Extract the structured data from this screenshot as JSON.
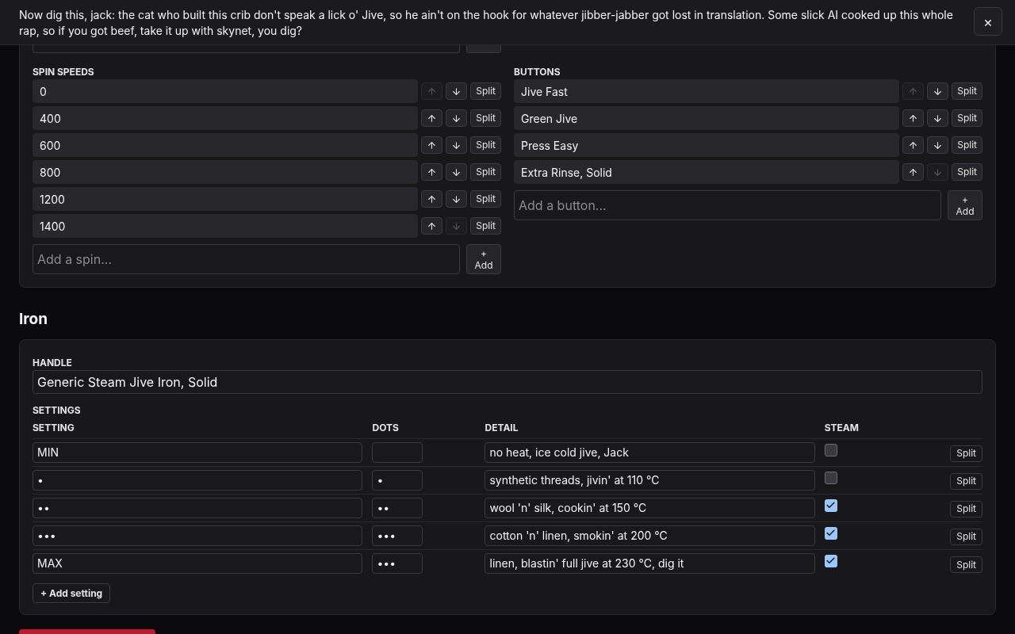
{
  "banner": {
    "text": "Now dig this, jack: the cat who built this crib don't speak a lick o' Jive, so he ain't on the hook for whatever jibber-jabber got lost in translation. Some slick AI cooked up this whole rap, so if you got beef, take it up with skynet, you dig?",
    "close": "×"
  },
  "spin_speeds": {
    "label": "SPIN SPEEDS",
    "items": [
      {
        "value": "0",
        "up_disabled": true,
        "down_disabled": false,
        "split": "Split"
      },
      {
        "value": "400",
        "up_disabled": false,
        "down_disabled": false,
        "split": "Split"
      },
      {
        "value": "600",
        "up_disabled": false,
        "down_disabled": false,
        "split": "Split"
      },
      {
        "value": "800",
        "up_disabled": false,
        "down_disabled": false,
        "split": "Split"
      },
      {
        "value": "1200",
        "up_disabled": false,
        "down_disabled": false,
        "split": "Split"
      },
      {
        "value": "1400",
        "up_disabled": false,
        "down_disabled": true,
        "split": "Split"
      }
    ],
    "placeholder": "Add a spin...",
    "add": [
      "+",
      "Add"
    ]
  },
  "buttons": {
    "label": "BUTTONS",
    "items": [
      {
        "value": "Jive Fast",
        "up_disabled": true,
        "down_disabled": false,
        "split": "Split"
      },
      {
        "value": "Green Jive",
        "up_disabled": false,
        "down_disabled": false,
        "split": "Split"
      },
      {
        "value": "Press Easy",
        "up_disabled": false,
        "down_disabled": false,
        "split": "Split"
      },
      {
        "value": "Extra Rinse, Solid",
        "up_disabled": false,
        "down_disabled": true,
        "split": "Split"
      }
    ],
    "placeholder": "Add a button...",
    "add": [
      "+",
      "Add"
    ]
  },
  "iron": {
    "title": "Iron",
    "handle_label": "HANDLE",
    "handle": "Generic Steam Jive Iron, Solid",
    "settings_label": "SETTINGS",
    "columns": [
      "SETTING",
      "DOTS",
      "DETAIL",
      "STEAM"
    ],
    "rows": [
      {
        "setting": "MIN",
        "dots": "",
        "detail": "no heat, ice cold jive, Jack",
        "steam": false,
        "split": "Split"
      },
      {
        "setting": "•",
        "dots": "•",
        "detail": "synthetic threads, jivin' at 110 °C",
        "steam": false,
        "split": "Split"
      },
      {
        "setting": "••",
        "dots": "••",
        "detail": "wool 'n' silk, cookin' at 150 °C",
        "steam": true,
        "split": "Split"
      },
      {
        "setting": "•••",
        "dots": "•••",
        "detail": "cotton 'n' linen, smokin' at 200 °C",
        "steam": true,
        "split": "Split"
      },
      {
        "setting": "MAX",
        "dots": "•••",
        "detail": "linen, blastin' full jive at 230 °C, dig it",
        "steam": true,
        "split": "Split"
      }
    ],
    "add_setting": "+ Add setting"
  }
}
